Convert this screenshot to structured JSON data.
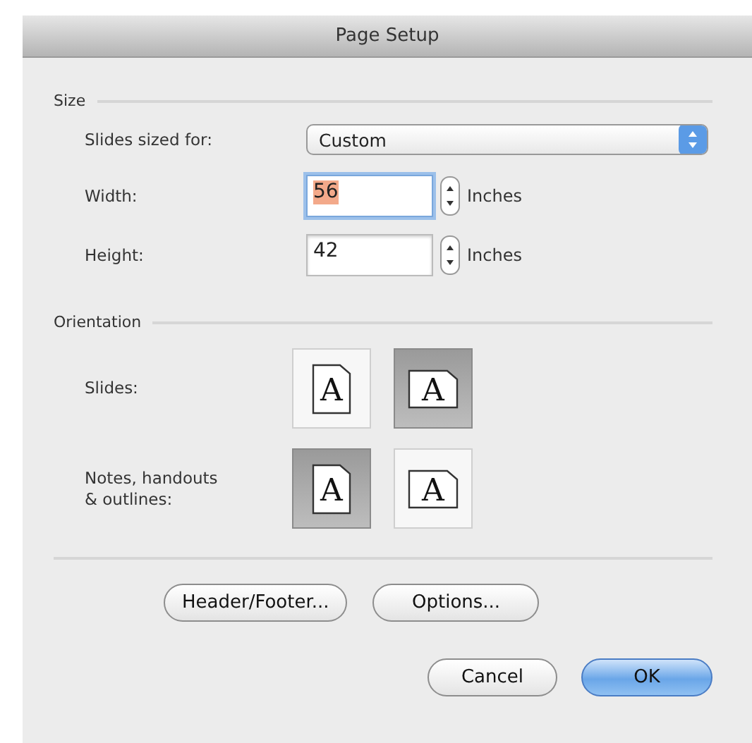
{
  "window": {
    "title": "Page Setup"
  },
  "size": {
    "heading": "Size",
    "slides_sized_for": {
      "label": "Slides sized for:",
      "value": "Custom"
    },
    "fields": [
      {
        "label": "Width:",
        "value": "56",
        "unit": "Inches",
        "focused": true
      },
      {
        "label": "Height:",
        "value": "42",
        "unit": "Inches",
        "focused": false
      }
    ]
  },
  "orientation": {
    "heading": "Orientation",
    "rows": [
      {
        "label": "Slides:",
        "options": [
          {
            "kind": "portrait",
            "glyph": "A",
            "selected": false
          },
          {
            "kind": "landscape",
            "glyph": "A",
            "selected": true
          }
        ]
      },
      {
        "label": "Notes, handouts\n& outlines:",
        "options": [
          {
            "kind": "portrait",
            "glyph": "A",
            "selected": true
          },
          {
            "kind": "landscape",
            "glyph": "A",
            "selected": false
          }
        ]
      }
    ]
  },
  "buttons": [
    {
      "label": "Header/Footer...",
      "default": false
    },
    {
      "label": "Options...",
      "default": false
    }
  ],
  "dialog_buttons": [
    {
      "label": "Cancel",
      "default": false
    },
    {
      "label": "OK",
      "default": true
    }
  ]
}
